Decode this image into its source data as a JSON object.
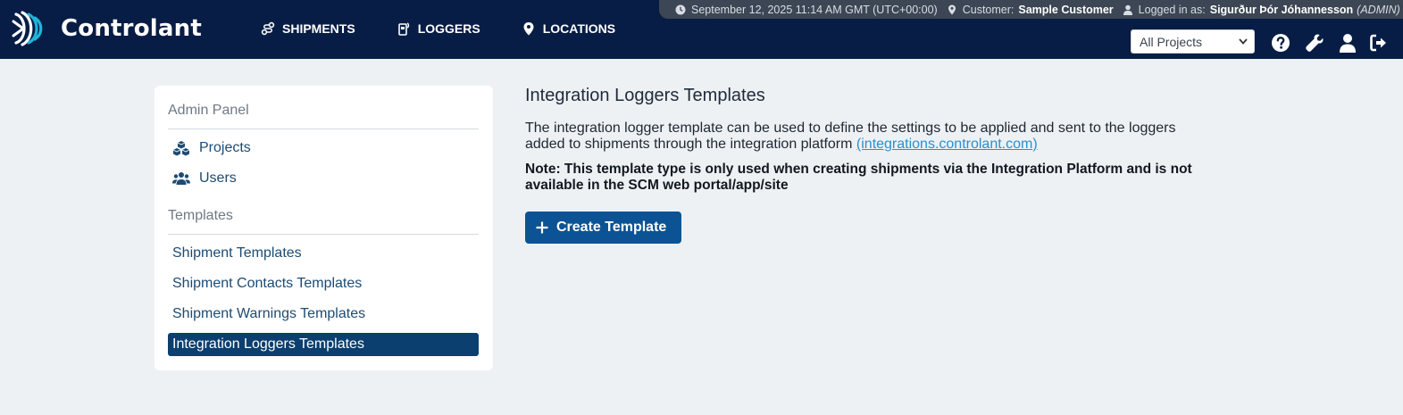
{
  "app": {
    "name": "Controlant"
  },
  "nav": [
    {
      "label": "SHIPMENTS",
      "icon": "route-icon"
    },
    {
      "label": "LOGGERS",
      "icon": "logger-device-icon"
    },
    {
      "label": "LOCATIONS",
      "icon": "map-pin-icon"
    }
  ],
  "status": {
    "datetime": "September 12, 2025 11:14 AM GMT (UTC+00:00)",
    "customer_label": "Customer:",
    "customer_name": "Sample Customer",
    "logged_in_label": "Logged in as:",
    "user_name": "Sigurður Þór Jóhannesson",
    "user_role": "(ADMIN)"
  },
  "project_select": {
    "value": "All Projects"
  },
  "header_icons": [
    "help-icon",
    "wrench-icon",
    "user-icon",
    "logout-icon"
  ],
  "sidebar": {
    "admin_title": "Admin Panel",
    "admin_items": [
      {
        "label": "Projects",
        "icon": "cubes-icon"
      },
      {
        "label": "Users",
        "icon": "users-icon"
      }
    ],
    "templates_title": "Templates",
    "template_items": [
      {
        "label": "Shipment Templates",
        "active": false
      },
      {
        "label": "Shipment Contacts Templates",
        "active": false
      },
      {
        "label": "Shipment Warnings Templates",
        "active": false
      },
      {
        "label": "Integration Loggers Templates",
        "active": true
      }
    ]
  },
  "main": {
    "title": "Integration Loggers Templates",
    "description": "The integration logger template can be used to define the settings to be applied and sent to the loggers added to shipments through the integration platform",
    "link_text": "(integrations.controlant.com)",
    "note": "Note: This template type is only used when creating shipments via the Integration Platform and is not available in the SCM web portal/app/site",
    "create_button_label": "Create Template"
  },
  "colors": {
    "header_bg": "#071d45",
    "status_bg": "#3c4654",
    "accent": "#0b5394",
    "active_item": "#0b3f6f",
    "link": "#2a8fd0",
    "logo_teal": "#1fb5d8"
  }
}
